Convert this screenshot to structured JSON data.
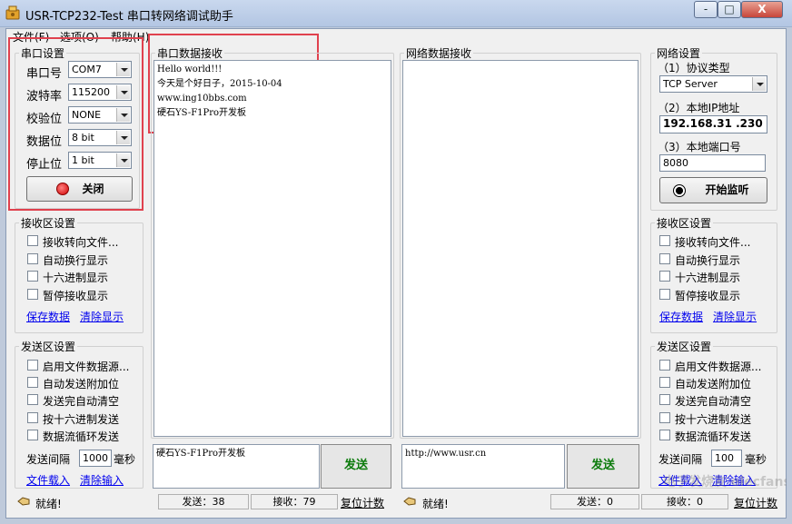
{
  "window": {
    "title": "USR-TCP232-Test 串口转网络调试助手",
    "controls": [
      "-",
      "□",
      "X"
    ]
  },
  "menu": [
    "文件(F)",
    "选项(O)",
    "帮助(H)"
  ],
  "serial_settings": {
    "title": "串口设置",
    "port_label": "串口号",
    "port_value": "COM7",
    "baud_label": "波特率",
    "baud_value": "115200",
    "parity_label": "校验位",
    "parity_value": "NONE",
    "data_label": "数据位",
    "data_value": "8 bit",
    "stop_label": "停止位",
    "stop_value": "1 bit",
    "close_button": "关闭"
  },
  "net_settings": {
    "title": "网络设置",
    "protocol_label": "（1）协议类型",
    "protocol_value": "TCP Server",
    "ip_label": "（2）本地IP地址",
    "ip_value": "192.168.31 .230",
    "port_label": "（3）本地端口号",
    "port_value": "8080",
    "listen_button": "开始监听"
  },
  "left_receive": {
    "title": "接收区设置",
    "options": [
      "接收转向文件...",
      "自动换行显示",
      "十六进制显示",
      "暂停接收显示"
    ],
    "save_link": "保存数据",
    "clear_link": "清除显示"
  },
  "left_send": {
    "title": "发送区设置",
    "options": [
      "启用文件数据源...",
      "自动发送附加位",
      "发送完自动清空",
      "按十六进制发送",
      "数据流循环发送"
    ],
    "interval_label": "发送间隔",
    "interval_value": "1000",
    "interval_unit": "毫秒",
    "load_link": "文件载入",
    "clear_link": "清除输入"
  },
  "right_receive": {
    "title": "接收区设置",
    "options": [
      "接收转向文件...",
      "自动换行显示",
      "十六进制显示",
      "暂停接收显示"
    ],
    "save_link": "保存数据",
    "clear_link": "清除显示"
  },
  "right_send": {
    "title": "发送区设置",
    "options": [
      "启用文件数据源...",
      "自动发送附加位",
      "发送完自动清空",
      "按十六进制发送",
      "数据流循环发送"
    ],
    "interval_label": "发送间隔",
    "interval_value": "100",
    "interval_unit": "毫秒",
    "load_link": "文件载入",
    "clear_link": "清除输入"
  },
  "serial_receive": {
    "title": "串口数据接收",
    "lines": [
      "Hello world!!!",
      "今天是个好日子，2015-10-04",
      "www.ing10bbs.com",
      "硬石YS-F1Pro开发板"
    ]
  },
  "net_receive": {
    "title": "网络数据接收"
  },
  "serial_send": {
    "text": "硬石YS-F1Pro开发板",
    "button": "发送"
  },
  "net_send": {
    "text": "http://www.usr.cn",
    "button": "发送"
  },
  "status_left": {
    "ready": "就绪!",
    "sent": "发送：38",
    "received": "接收：79",
    "reset": "复位计数"
  },
  "status_right": {
    "ready": "就绪!",
    "sent": "发送：0",
    "received": "接收：0",
    "reset": "复位计数"
  },
  "watermark": "电子发烧友 elecfans.com",
  "colors": {
    "highlight": "#e0414e",
    "send_text": "#0a7a0a",
    "link": "#0000ee"
  }
}
